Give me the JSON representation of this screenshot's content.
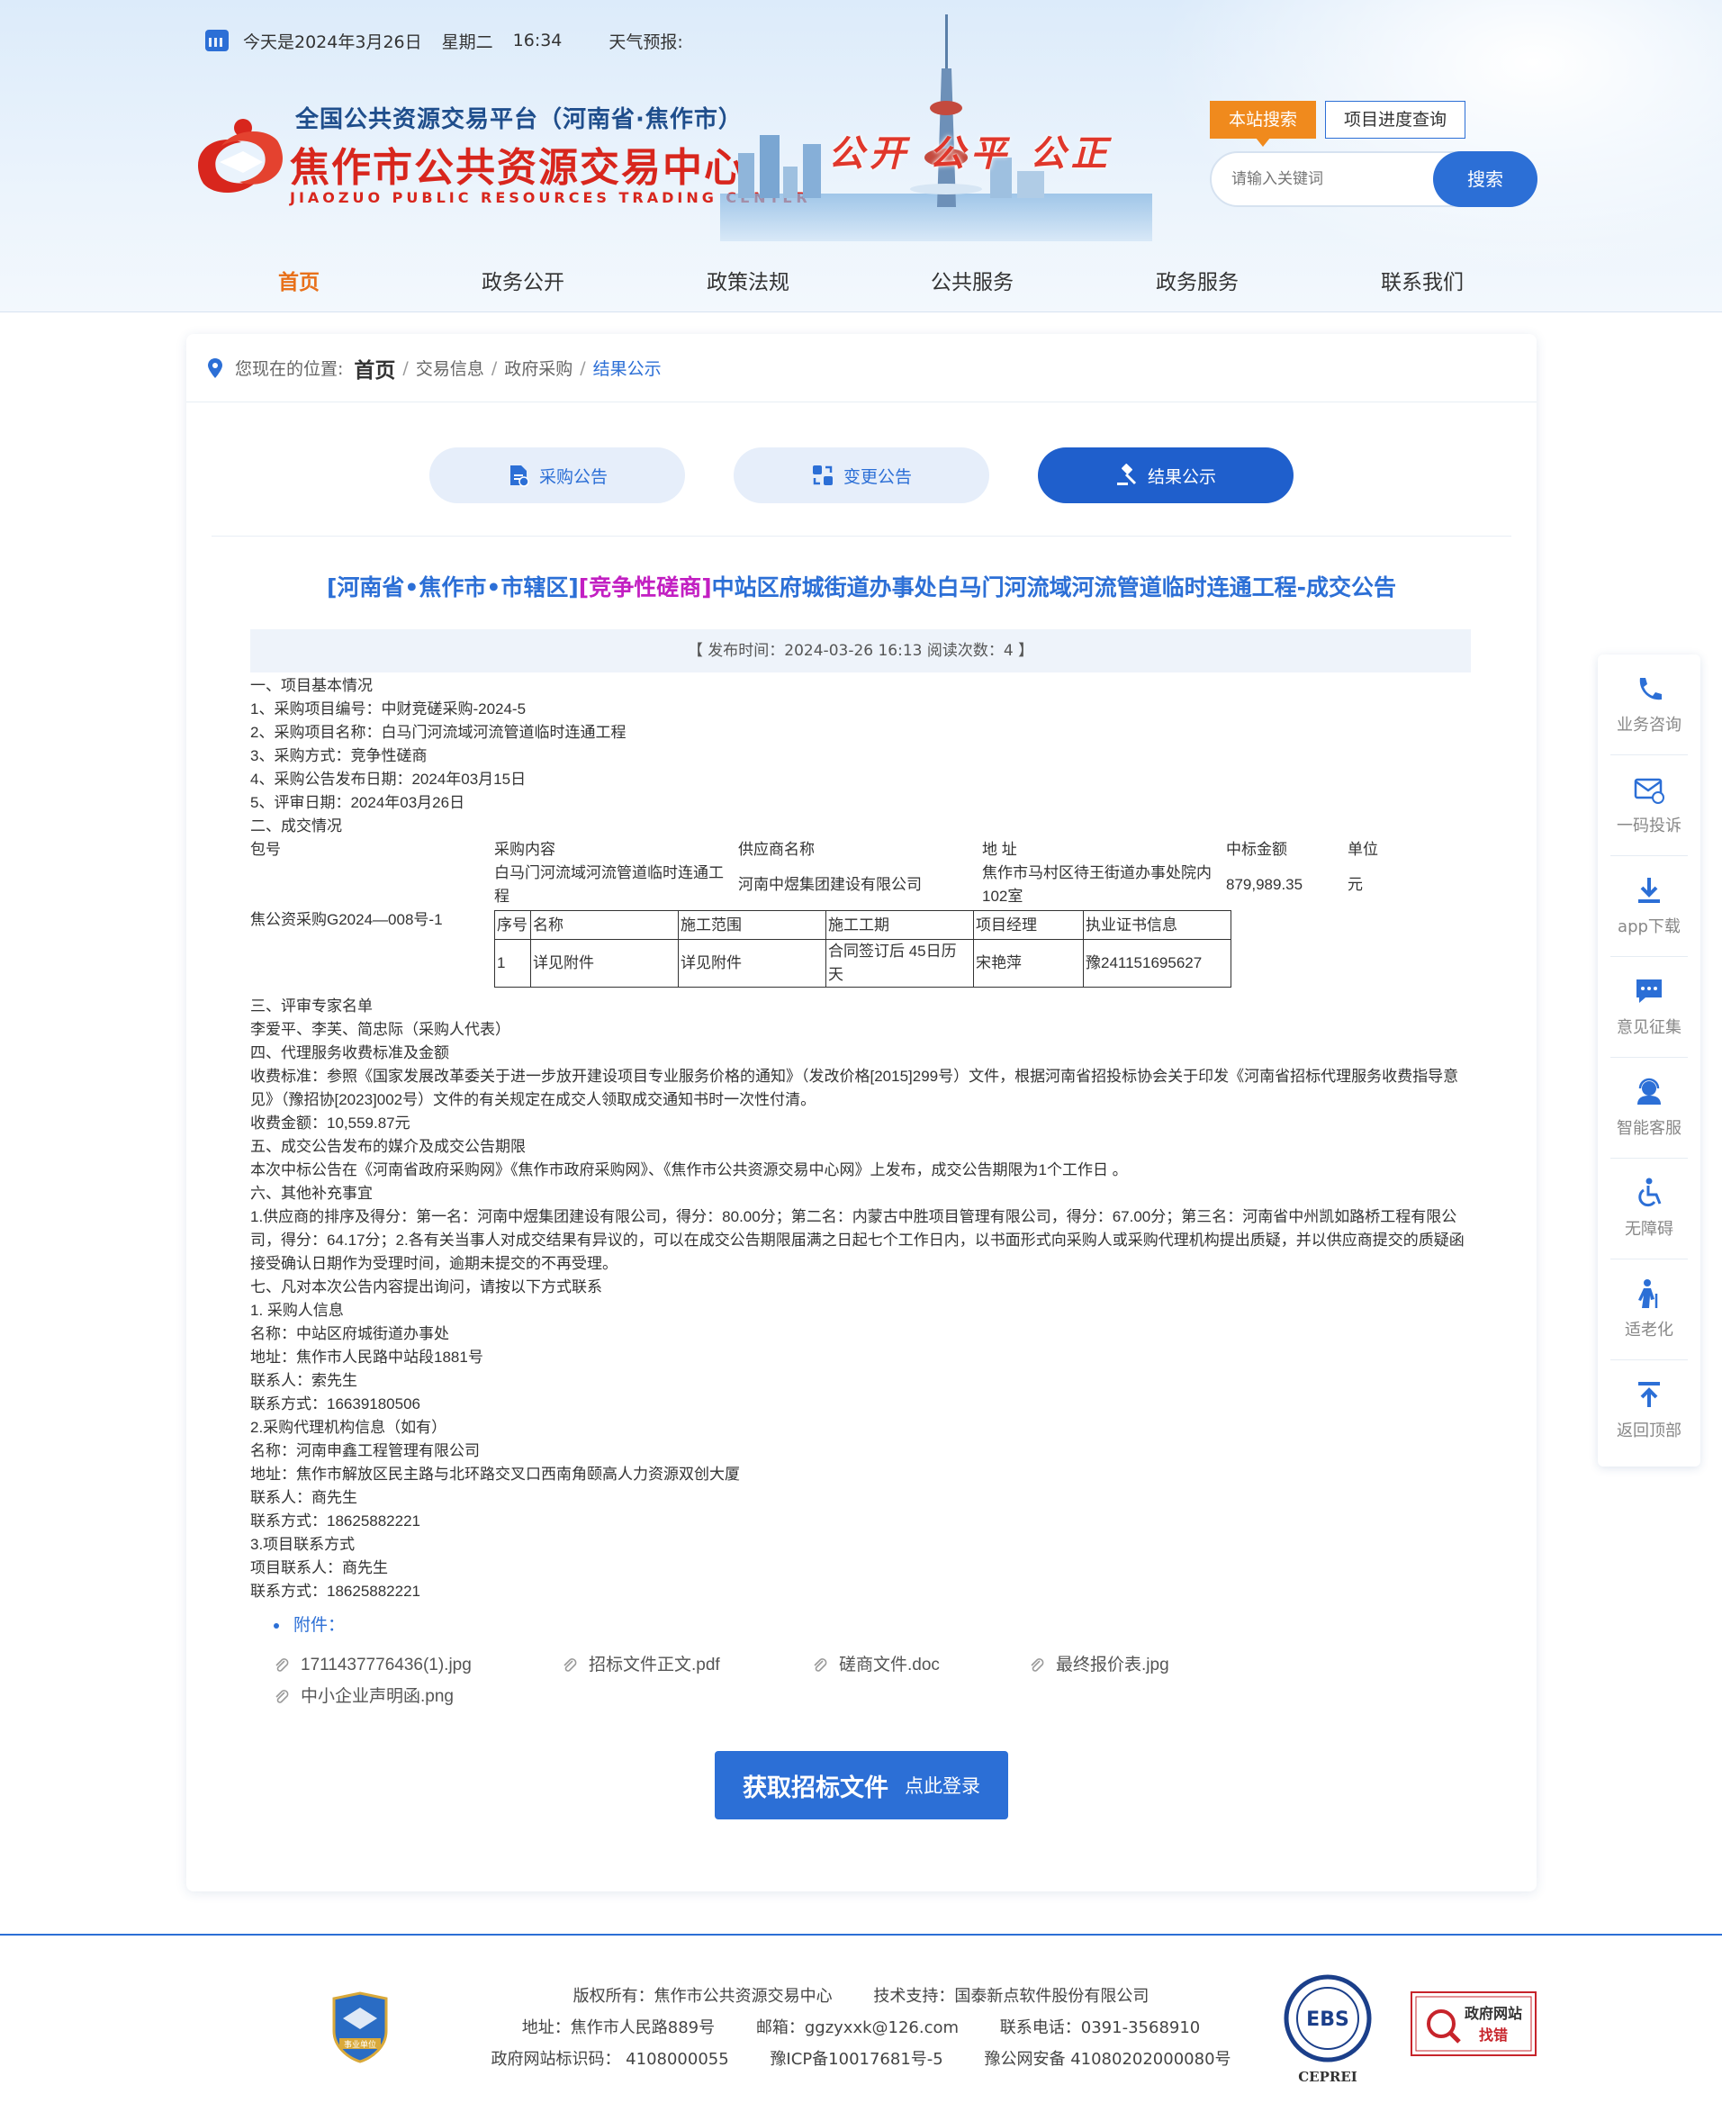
{
  "topbar": {
    "date": "今天是2024年3月26日",
    "weekday": "星期二",
    "time": "16:34",
    "weather": "天气预报:"
  },
  "brand": {
    "line1": "全国公共资源交易平台（河南省·焦作市）",
    "line2": "焦作市公共资源交易中心",
    "line3": "JIAOZUO PUBLIC RESOURCES TRADING CENTER",
    "slogan": "公开 公平 公正",
    "red": "#d8261d",
    "navy": "#1f4e8c"
  },
  "search": {
    "tab_active": "本站搜索",
    "tab_other": "项目进度查询",
    "placeholder": "请输入关键词",
    "button": "搜索"
  },
  "nav": {
    "items": [
      "首页",
      "政务公开",
      "政策法规",
      "公共服务",
      "政务服务",
      "联系我们"
    ]
  },
  "breadcrumb": {
    "prefix": "您现在的位置:",
    "home": "首页",
    "l1": "交易信息",
    "l2": "政府采购",
    "current": "结果公示"
  },
  "content_tabs": [
    "采购公告",
    "变更公告",
    "结果公示"
  ],
  "article": {
    "title_region": "[河南省•焦作市•市辖区]",
    "title_method": "[竞争性磋商]",
    "title_main": "中站区府城街道办事处白马门河流域河流管道临时连通工程-成交公告",
    "meta": "【 发布时间：2024-03-26 16:13    阅读次数：4  】",
    "lines_a": [
      "一、项目基本情况",
      "1、采购项目编号：中财竞磋采购-2024-5",
      "2、采购项目名称：白马门河流域河流管道临时连通工程",
      "3、采购方式：竞争性磋商",
      "4、采购公告发布日期：2024年03月15日",
      "5、评审日期：2024年03月26日",
      "二、成交情况"
    ],
    "deal": {
      "headers": [
        "包号",
        "采购内容",
        "供应商名称",
        "地 址",
        "中标金额",
        "单位"
      ],
      "package": "焦公资采购G2024—008号-1",
      "content": "白马门河流域河流管道临时连通工程",
      "supplier": "河南中煜集团建设有限公司",
      "address": "焦作市马村区待王街道办事处院内102室",
      "amount": "879,989.35",
      "unit": "元",
      "sub_headers": [
        "序号",
        "名称",
        "施工范围",
        "施工工期",
        "项目经理",
        "执业证书信息"
      ],
      "sub_row": [
        "1",
        "详见附件",
        "详见附件",
        "合同签订后 45日历天",
        "宋艳萍",
        "豫241151695627"
      ]
    },
    "lines_b": [
      "三、评审专家名单",
      "李爱平、李芙、简忠际（采购人代表）",
      "四、代理服务收费标准及金额",
      "收费标准：参照《国家发展改革委关于进一步放开建设项目专业服务价格的通知》（发改价格[2015]299号）文件，根据河南省招投标协会关于印发《河南省招标代理服务收费指导意见》（豫招协[2023]002号）文件的有关规定在成交人领取成交通知书时一次性付清。",
      "收费金额：10,559.87元",
      "五、成交公告发布的媒介及成交公告期限",
      "本次中标公告在《河南省政府采购网》《焦作市政府采购网》、《焦作市公共资源交易中心网》上发布，成交公告期限为1个工作日 。",
      "六、其他补充事宜",
      "1.供应商的排序及得分：第一名：河南中煜集团建设有限公司，得分：80.00分；第二名：内蒙古中胜项目管理有限公司，得分：67.00分；第三名：河南省中州凯如路桥工程有限公司，得分：64.17分；2.各有关当事人对成交结果有异议的，可以在成交公告期限届满之日起七个工作日内，以书面形式向采购人或采购代理机构提出质疑，并以供应商提交的质疑函接受确认日期作为受理时间，逾期未提交的不再受理。",
      "七、凡对本次公告内容提出询问，请按以下方式联系",
      "1. 采购人信息",
      "名称：中站区府城街道办事处",
      "地址：焦作市人民路中站段1881号",
      "联系人：索先生",
      "联系方式：16639180506",
      "2.采购代理机构信息（如有）",
      "名称：河南申鑫工程管理有限公司",
      "地址：焦作市解放区民主路与北环路交叉口西南角颐高人力资源双创大厦",
      "联系人：商先生",
      "联系方式：18625882221",
      "3.项目联系方式",
      "项目联系人：商先生",
      "联系方式：18625882221"
    ],
    "attachments_title": "附件：",
    "attachments": [
      "1711437776436(1).jpg",
      "招标文件正文.pdf",
      "磋商文件.doc",
      "最终报价表.jpg",
      "中小企业声明函.png"
    ],
    "get_button_big": "获取招标文件",
    "get_button_small": "点此登录"
  },
  "sidebar": [
    "业务咨询",
    "一码投诉",
    "app下载",
    "意见征集",
    "智能客服",
    "无障碍",
    "适老化",
    "返回顶部"
  ],
  "footer": {
    "copyright": "版权所有：焦作市公共资源交易中心",
    "support": "技术支持：国泰新点软件股份有限公司",
    "address": "地址：焦作市人民路889号",
    "email": "邮箱：ggzyxxk@126.com",
    "phone": "联系电话：0391-3568910",
    "site_code": "政府网站标识码：  4108000055",
    "icp": "豫ICP备10017681号-5",
    "police": "豫公网安备 41080202000080号",
    "badge_unit": "事业单位",
    "badge_ebs": "EBS",
    "badge_cepeei": "CEPREI",
    "badge_gov": "政府网站",
    "badge_find": "找错"
  },
  "colors": {
    "primary": "#2c6fd6",
    "accent_orange": "#e8701a",
    "search_tab": "#f08a1d",
    "magenta": "#c21fc2"
  }
}
